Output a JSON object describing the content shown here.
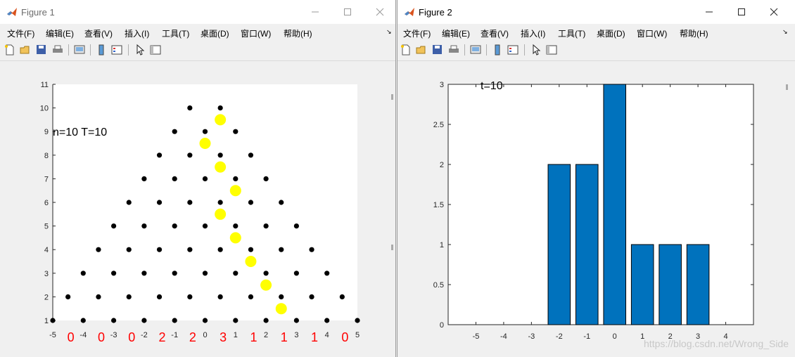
{
  "figure1": {
    "title": "Figure 1",
    "menus": [
      "文件(F)",
      "编辑(E)",
      "查看(V)",
      "插入(I)",
      "工具(T)",
      "桌面(D)",
      "窗口(W)",
      "帮助(H)"
    ],
    "annotation": "n=10 T=10",
    "x_ticks": [
      "-5",
      "-4",
      "-3",
      "-2",
      "-1",
      "0",
      "1",
      "2",
      "3",
      "4",
      "5"
    ],
    "y_ticks": [
      "1",
      "2",
      "3",
      "4",
      "5",
      "6",
      "7",
      "8",
      "9",
      "10",
      "11"
    ],
    "count_labels": [
      "0",
      "0",
      "0",
      "2",
      "2",
      "3",
      "1",
      "1",
      "1",
      "0"
    ],
    "colors": {
      "grid_points": "#000000",
      "path": "#ffff00",
      "counts": "#ff0000"
    }
  },
  "figure2": {
    "title": "Figure 2",
    "menus": [
      "文件(F)",
      "编辑(E)",
      "查看(V)",
      "插入(I)",
      "工具(T)",
      "桌面(D)",
      "窗口(W)",
      "帮助(H)"
    ],
    "annotation": "t=10",
    "watermark": "https://blog.csdn.net/Wrong_Side"
  },
  "chart_data": [
    {
      "type": "scatter",
      "annotation": "n=10 T=10",
      "xlim": [
        -5,
        5
      ],
      "ylim": [
        1,
        11
      ],
      "series": [
        {
          "points": [
            [
              -5,
              1
            ],
            [
              -4,
              1
            ],
            [
              -3,
              1
            ],
            [
              -2,
              1
            ],
            [
              -1,
              1
            ],
            [
              0,
              1
            ],
            [
              1,
              1
            ],
            [
              2,
              1
            ],
            [
              3,
              1
            ],
            [
              4,
              1
            ],
            [
              5,
              1
            ],
            [
              -4.5,
              2
            ],
            [
              -3.5,
              2
            ],
            [
              -2.5,
              2
            ],
            [
              -1.5,
              2
            ],
            [
              -0.5,
              2
            ],
            [
              0.5,
              2
            ],
            [
              1.5,
              2
            ],
            [
              2.5,
              2
            ],
            [
              3.5,
              2
            ],
            [
              4.5,
              2
            ],
            [
              -4,
              3
            ],
            [
              -3,
              3
            ],
            [
              -2,
              3
            ],
            [
              -1,
              3
            ],
            [
              0,
              3
            ],
            [
              1,
              3
            ],
            [
              2,
              3
            ],
            [
              3,
              3
            ],
            [
              4,
              3
            ],
            [
              -3.5,
              4
            ],
            [
              -2.5,
              4
            ],
            [
              -1.5,
              4
            ],
            [
              -0.5,
              4
            ],
            [
              0.5,
              4
            ],
            [
              1.5,
              4
            ],
            [
              2.5,
              4
            ],
            [
              3.5,
              4
            ],
            [
              -3,
              5
            ],
            [
              -2,
              5
            ],
            [
              -1,
              5
            ],
            [
              0,
              5
            ],
            [
              1,
              5
            ],
            [
              2,
              5
            ],
            [
              3,
              5
            ],
            [
              -2.5,
              6
            ],
            [
              -1.5,
              6
            ],
            [
              -0.5,
              6
            ],
            [
              0.5,
              6
            ],
            [
              1.5,
              6
            ],
            [
              2.5,
              6
            ],
            [
              -2,
              7
            ],
            [
              -1,
              7
            ],
            [
              0,
              7
            ],
            [
              1,
              7
            ],
            [
              2,
              7
            ],
            [
              -1.5,
              8
            ],
            [
              -0.5,
              8
            ],
            [
              0.5,
              8
            ],
            [
              1.5,
              8
            ],
            [
              -1,
              9
            ],
            [
              0,
              9
            ],
            [
              1,
              9
            ],
            [
              -0.5,
              10
            ],
            [
              0.5,
              10
            ]
          ]
        },
        {
          "points": [
            [
              0.5,
              9.5
            ],
            [
              0,
              8.5
            ],
            [
              0.5,
              7.5
            ],
            [
              1,
              6.5
            ],
            [
              0.5,
              5.5
            ],
            [
              1,
              4.5
            ],
            [
              1.5,
              3.5
            ],
            [
              2,
              2.5
            ],
            [
              2.5,
              1.5
            ]
          ]
        }
      ],
      "bin_counts": {
        "x": [
          -4.5,
          -3.5,
          -2.5,
          -1.5,
          -0.5,
          0.5,
          1.5,
          2.5,
          3.5,
          4.5
        ],
        "values": [
          0,
          0,
          0,
          2,
          2,
          3,
          1,
          1,
          1,
          0
        ]
      }
    },
    {
      "type": "bar",
      "annotation": "t=10",
      "categories": [
        -2,
        -1,
        0,
        1,
        2,
        3
      ],
      "values": [
        2,
        2,
        3,
        1,
        1,
        1
      ],
      "xlim": [
        -6,
        5
      ],
      "ylim": [
        0,
        3
      ],
      "x_ticks": [
        "-5",
        "-4",
        "-3",
        "-2",
        "-1",
        "0",
        "1",
        "2",
        "3",
        "4"
      ],
      "y_ticks": [
        "0",
        "0.5",
        "1",
        "1.5",
        "2",
        "2.5",
        "3"
      ],
      "bar_color": "#0072bd"
    }
  ]
}
